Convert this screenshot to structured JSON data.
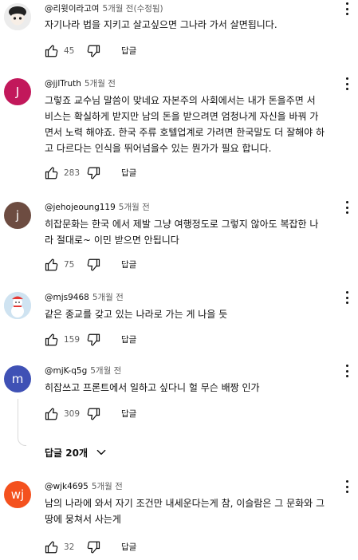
{
  "ui": {
    "reply_label": "답글",
    "like_icon": "thumb-up-outline-icon",
    "dislike_icon": "thumb-down-outline-icon",
    "menu_icon": "more-vert-icon"
  },
  "comments": [
    {
      "author": "@리윗이라고여",
      "time": "5개월 전(수정됨)",
      "avatar_letter": "",
      "avatar_color": "#e9e9e9",
      "lines": [
        "자기나라 법을  지키고 살고싶으면 그나라 가서 살면됩니다."
      ],
      "likes": "45"
    },
    {
      "author": "@jjlTruth",
      "time": "5개월 전",
      "avatar_letter": "J",
      "avatar_color": "#c2185b",
      "lines": [
        "그렇죠 교수님 말씀이 맞네요 자본주의 사회에서는 내가 돈을주면 서",
        "비스는 확실하게 받지만 남의 돈을 받으려면 엄청나게 자신을 바꿔 가",
        "면서 노력 해야죠. 한국 주류 호텔업계로 가려면 한국말도 더 잘해야 하",
        "고 다르다는 인식을 뛰어넘을수 있는 뭔가가 필요 합니다."
      ],
      "likes": "283"
    },
    {
      "author": "@jehojeoung119",
      "time": "5개월 전",
      "avatar_letter": "j",
      "avatar_color": "#6d4c41",
      "lines": [
        "히잡문화는 한국 에서 제발 그냥 여행정도로 그렇지 않아도 복잡한 나",
        "라 절대로~  이민 받으면 안됩니다"
      ],
      "likes": "75"
    },
    {
      "author": "@mjs9468",
      "time": "5개월 전",
      "avatar_letter": "",
      "avatar_color": "#cfe3f1",
      "lines": [
        "같은 종교를 갖고 있는 나라로 가는 게 나을 듯"
      ],
      "likes": "159"
    },
    {
      "author": "@mjK-q5g",
      "time": "5개월 전",
      "avatar_letter": "m",
      "avatar_color": "#3f51b5",
      "lines": [
        "히잡쓰고 프론트에서 일하고 싶다니 헐 무슨 배짱 인가"
      ],
      "likes": "309",
      "replies_label": "답글 20개"
    },
    {
      "author": "@wjk4695",
      "time": "5개월 전",
      "avatar_letter": "wj",
      "avatar_color": "#f4511e",
      "lines": [
        "남의 나라에 와서 자기 조건만 내세운다는게 참, 이슬람은 그 문화와 그",
        "땅에 뭉쳐서 사는게"
      ],
      "likes": "32"
    }
  ]
}
